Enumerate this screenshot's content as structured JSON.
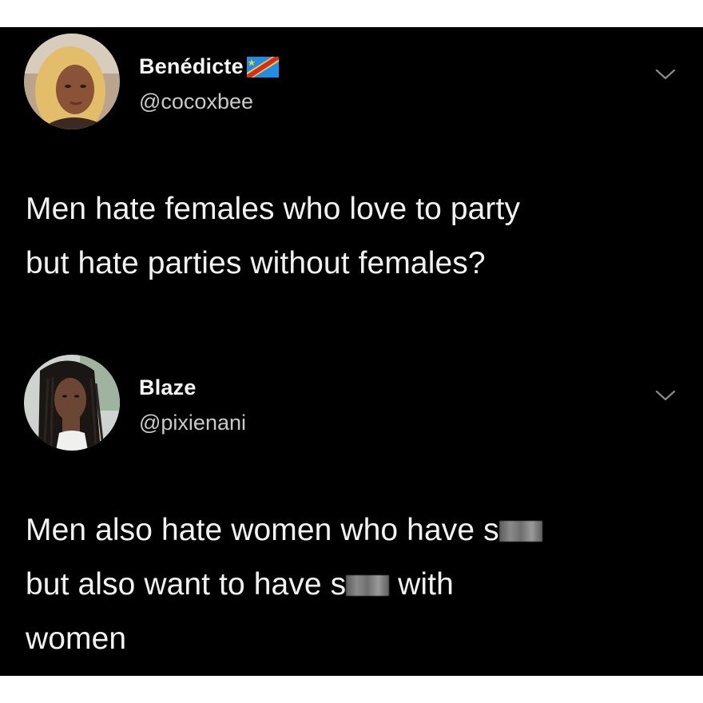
{
  "tweets": [
    {
      "display_name": "Benédicte",
      "handle": "@cocoxbee",
      "flag_icon": "drc-flag-icon",
      "menu_icon": "chevron-down-icon",
      "text_line1": "Men hate females who love to party",
      "text_line2": "but hate parties without females?"
    },
    {
      "display_name": "Blaze",
      "handle": "@pixienani",
      "menu_icon": "chevron-down-icon",
      "text_line1_a": "Men also hate women who have s",
      "text_line2_a": "but also want to have s",
      "text_line2_b": " with",
      "text_line3": "women"
    }
  ],
  "colors": {
    "background": "#000000",
    "page": "#ffffff",
    "text": "#f2f2f2",
    "muted": "#c9c9c9"
  }
}
